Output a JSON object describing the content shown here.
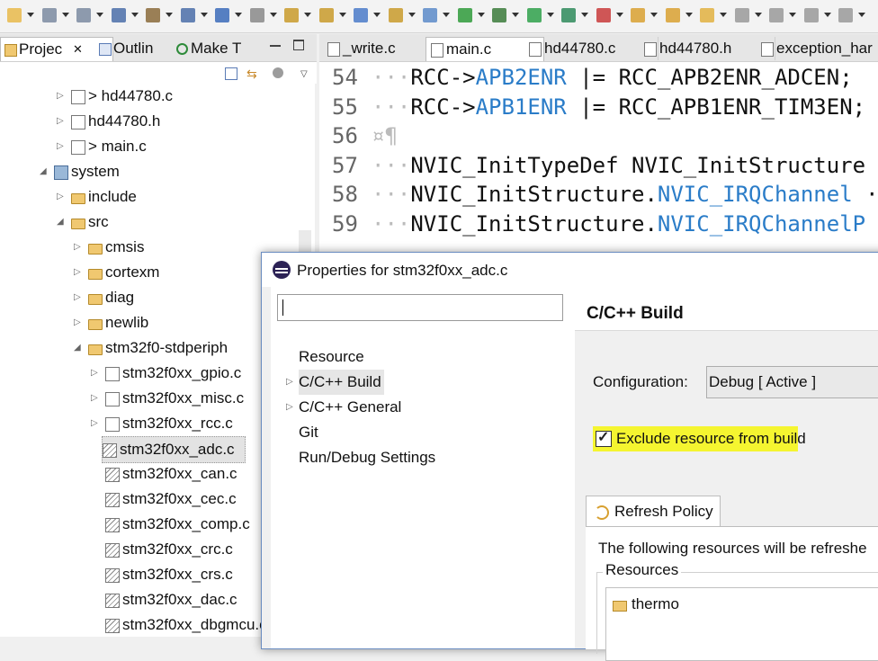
{
  "toolbar": {
    "icons": [
      "new-icon",
      "save-icon",
      "save-all-icon",
      "build-settings-icon",
      "build-icon",
      "binary-icon",
      "console-icon",
      "debug-config-icon",
      "refresh-icon",
      "package-icon",
      "new-project-icon",
      "new-folder-icon",
      "new-class-icon",
      "run-history-icon",
      "debug-icon",
      "run-icon",
      "coverage-icon",
      "stop-icon",
      "open-folder-icon",
      "open-type-icon",
      "search-icon",
      "annotate-icon",
      "toggle-icon",
      "pin-icon",
      "navigate-icon"
    ]
  },
  "left_view": {
    "tabs": [
      {
        "label": "Projec",
        "icon": "project-explorer-icon",
        "closable": true
      },
      {
        "label": "Outlin",
        "icon": "outline-icon"
      },
      {
        "label": "Make T",
        "icon": "make-target-icon"
      }
    ],
    "tree": [
      {
        "label": "> hd44780.c",
        "icon": "c-file-icon",
        "level": 3,
        "twisty": "▷"
      },
      {
        "label": "hd44780.h",
        "icon": "h-file-icon",
        "level": 3,
        "twisty": "▷"
      },
      {
        "label": "> main.c",
        "icon": "c-file-icon",
        "level": 3,
        "twisty": "▷"
      },
      {
        "label": "system",
        "icon": "project-folder-icon",
        "level": 2,
        "twisty": "◢"
      },
      {
        "label": "include",
        "icon": "folder-icon",
        "level": 3,
        "twisty": "▷"
      },
      {
        "label": "src",
        "icon": "folder-icon",
        "level": 3,
        "twisty": "◢"
      },
      {
        "label": "cmsis",
        "icon": "folder-icon",
        "level": 4,
        "twisty": "▷"
      },
      {
        "label": "cortexm",
        "icon": "folder-icon",
        "level": 4,
        "twisty": "▷"
      },
      {
        "label": "diag",
        "icon": "folder-icon",
        "level": 4,
        "twisty": "▷"
      },
      {
        "label": "newlib",
        "icon": "folder-icon",
        "level": 4,
        "twisty": "▷"
      },
      {
        "label": "stm32f0-stdperiph",
        "icon": "folder-icon",
        "level": 4,
        "twisty": "◢"
      },
      {
        "label": "stm32f0xx_gpio.c",
        "icon": "c-file-icon",
        "level": 5,
        "twisty": "▷"
      },
      {
        "label": "stm32f0xx_misc.c",
        "icon": "c-file-icon",
        "level": 5,
        "twisty": "▷"
      },
      {
        "label": "stm32f0xx_rcc.c",
        "icon": "c-file-icon",
        "level": 5,
        "twisty": "▷"
      },
      {
        "label": "stm32f0xx_adc.c",
        "icon": "excluded-file-icon",
        "level": 5,
        "twisty": "",
        "selected": true
      },
      {
        "label": "stm32f0xx_can.c",
        "icon": "excluded-file-icon",
        "level": 5,
        "twisty": ""
      },
      {
        "label": "stm32f0xx_cec.c",
        "icon": "excluded-file-icon",
        "level": 5,
        "twisty": ""
      },
      {
        "label": "stm32f0xx_comp.c",
        "icon": "excluded-file-icon",
        "level": 5,
        "twisty": ""
      },
      {
        "label": "stm32f0xx_crc.c",
        "icon": "excluded-file-icon",
        "level": 5,
        "twisty": ""
      },
      {
        "label": "stm32f0xx_crs.c",
        "icon": "excluded-file-icon",
        "level": 5,
        "twisty": ""
      },
      {
        "label": "stm32f0xx_dac.c",
        "icon": "excluded-file-icon",
        "level": 5,
        "twisty": ""
      },
      {
        "label": "stm32f0xx_dbgmcu.c",
        "icon": "excluded-file-icon",
        "level": 5,
        "twisty": ""
      }
    ]
  },
  "editor": {
    "tabs": [
      {
        "label": "_write.c",
        "active": false
      },
      {
        "label": "main.c",
        "active": true,
        "closable": true
      },
      {
        "label": "hd44780.c",
        "active": false
      },
      {
        "label": "hd44780.h",
        "active": false
      },
      {
        "label": "exception_har",
        "active": false
      }
    ],
    "lines": [
      {
        "num": "54",
        "ws": "···",
        "pre": "RCC->",
        "field": "APB2ENR",
        "post": " |= RCC_APB2ENR_ADCEN;"
      },
      {
        "num": "55",
        "ws": "···",
        "pre": "RCC->",
        "field": "APB1ENR",
        "post": " |= RCC_APB1ENR_TIM3EN;"
      },
      {
        "num": "56",
        "ws": "¤¶",
        "pre": "",
        "field": "",
        "post": ""
      },
      {
        "num": "57",
        "ws": "···",
        "pre": "NVIC_InitTypeDef NVIC_InitStructure",
        "field": "",
        "post": ""
      },
      {
        "num": "58",
        "ws": "···",
        "pre": "NVIC_InitStructure.",
        "field": "NVIC_IRQChannel",
        "post": " ·"
      },
      {
        "num": "59",
        "ws": "···",
        "pre": "NVIC_InitStructure.",
        "field": "NVIC_IRQChannelP",
        "post": ""
      }
    ]
  },
  "dialog": {
    "title": "Properties for stm32f0xx_adc.c",
    "filter_value": "",
    "nav_items": [
      {
        "label": "Resource",
        "twisty": ""
      },
      {
        "label": "C/C++ Build",
        "twisty": "▷",
        "selected": true
      },
      {
        "label": "C/C++ General",
        "twisty": "▷"
      },
      {
        "label": "Git",
        "twisty": ""
      },
      {
        "label": "Run/Debug Settings",
        "twisty": ""
      }
    ],
    "page_title": "C/C++ Build",
    "config_label": "Configuration:",
    "config_value": "Debug  [ Active ]",
    "exclude_label": "Exclude resource from build",
    "exclude_checked": true,
    "highlight_color": "#f5f530",
    "refresh_tab": "Refresh Policy",
    "refresh_desc": "The following resources will be refreshe",
    "resources_label": "Resources",
    "resource_item": "thermo"
  }
}
